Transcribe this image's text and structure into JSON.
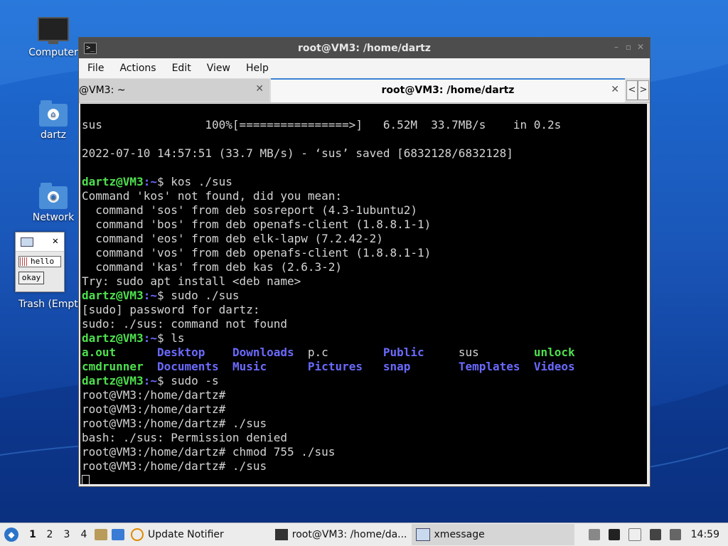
{
  "desktop": {
    "icons": [
      {
        "label": "Computer",
        "icon": "computer-icon"
      },
      {
        "label": "dartz",
        "icon": "home-folder-icon"
      },
      {
        "label": "Network",
        "icon": "network-folder-icon"
      },
      {
        "label": "Trash (Empty)",
        "icon": "trash-icon"
      }
    ]
  },
  "xmessage": {
    "text": "hello",
    "button": "okay",
    "close": "✕"
  },
  "window": {
    "title": "root@VM3: /home/dartz",
    "menu": [
      "File",
      "Edit",
      "View",
      "Help",
      "Actions"
    ],
    "menu_items": {
      "file": "File",
      "actions": "Actions",
      "edit": "Edit",
      "view": "View",
      "help": "Help"
    },
    "tabs": [
      {
        "label": "@VM3: ~",
        "active": false
      },
      {
        "label": "root@VM3: /home/dartz",
        "active": true
      }
    ],
    "tab_close": "✕",
    "nav_prev": "<",
    "nav_next": ">"
  },
  "terminal": {
    "l1": "sus               100%[================>]   6.52M  33.7MB/s    in 0.2s",
    "l2": "",
    "l3": "2022-07-10 14:57:51 (33.7 MB/s) - ‘sus’ saved [6832128/6832128]",
    "l4": "",
    "prompt_user": "dartz@VM3",
    "prompt_path": ":~",
    "cmd1": "$ kos ./sus",
    "l6": "Command 'kos' not found, did you mean:",
    "l7": "  command 'sos' from deb sosreport (4.3-1ubuntu2)",
    "l8": "  command 'bos' from deb openafs-client (1.8.8.1-1)",
    "l9": "  command 'eos' from deb elk-lapw (7.2.42-2)",
    "l10": "  command 'vos' from deb openafs-client (1.8.8.1-1)",
    "l11": "  command 'kas' from deb kas (2.6.3-2)",
    "l12": "Try: sudo apt install <deb name>",
    "cmd2": "$ sudo ./sus",
    "l14": "[sudo] password for dartz:",
    "l15": "sudo: ./sus: command not found",
    "cmd3": "$ ls",
    "ls_row1": [
      {
        "name": "a.out",
        "kind": "exec"
      },
      {
        "name": "Desktop",
        "kind": "dir"
      },
      {
        "name": "Downloads",
        "kind": "dir"
      },
      {
        "name": "p.c",
        "kind": "file"
      },
      {
        "name": "Public",
        "kind": "dir"
      },
      {
        "name": "sus",
        "kind": "file"
      },
      {
        "name": "unlock",
        "kind": "exec"
      }
    ],
    "ls_row2": [
      {
        "name": "cmdrunner",
        "kind": "exec"
      },
      {
        "name": "Documents",
        "kind": "dir"
      },
      {
        "name": "Music",
        "kind": "dir"
      },
      {
        "name": "Pictures",
        "kind": "dir"
      },
      {
        "name": "snap",
        "kind": "dir"
      },
      {
        "name": "Templates",
        "kind": "dir"
      },
      {
        "name": "Videos",
        "kind": "dir"
      }
    ],
    "cmd4": "$ sudo -s",
    "l20": "root@VM3:/home/dartz#",
    "l21": "root@VM3:/home/dartz#",
    "l22": "root@VM3:/home/dartz# ./sus",
    "l23": "bash: ./sus: Permission denied",
    "l24": "root@VM3:/home/dartz# chmod 755 ./sus",
    "l25": "root@VM3:/home/dartz# ./sus"
  },
  "taskbar": {
    "workspaces": [
      "1",
      "2",
      "3",
      "4"
    ],
    "tasks": [
      {
        "label": "Update Notifier"
      },
      {
        "label": "root@VM3: /home/da..."
      },
      {
        "label": "xmessage"
      }
    ],
    "clock": "14:59"
  }
}
